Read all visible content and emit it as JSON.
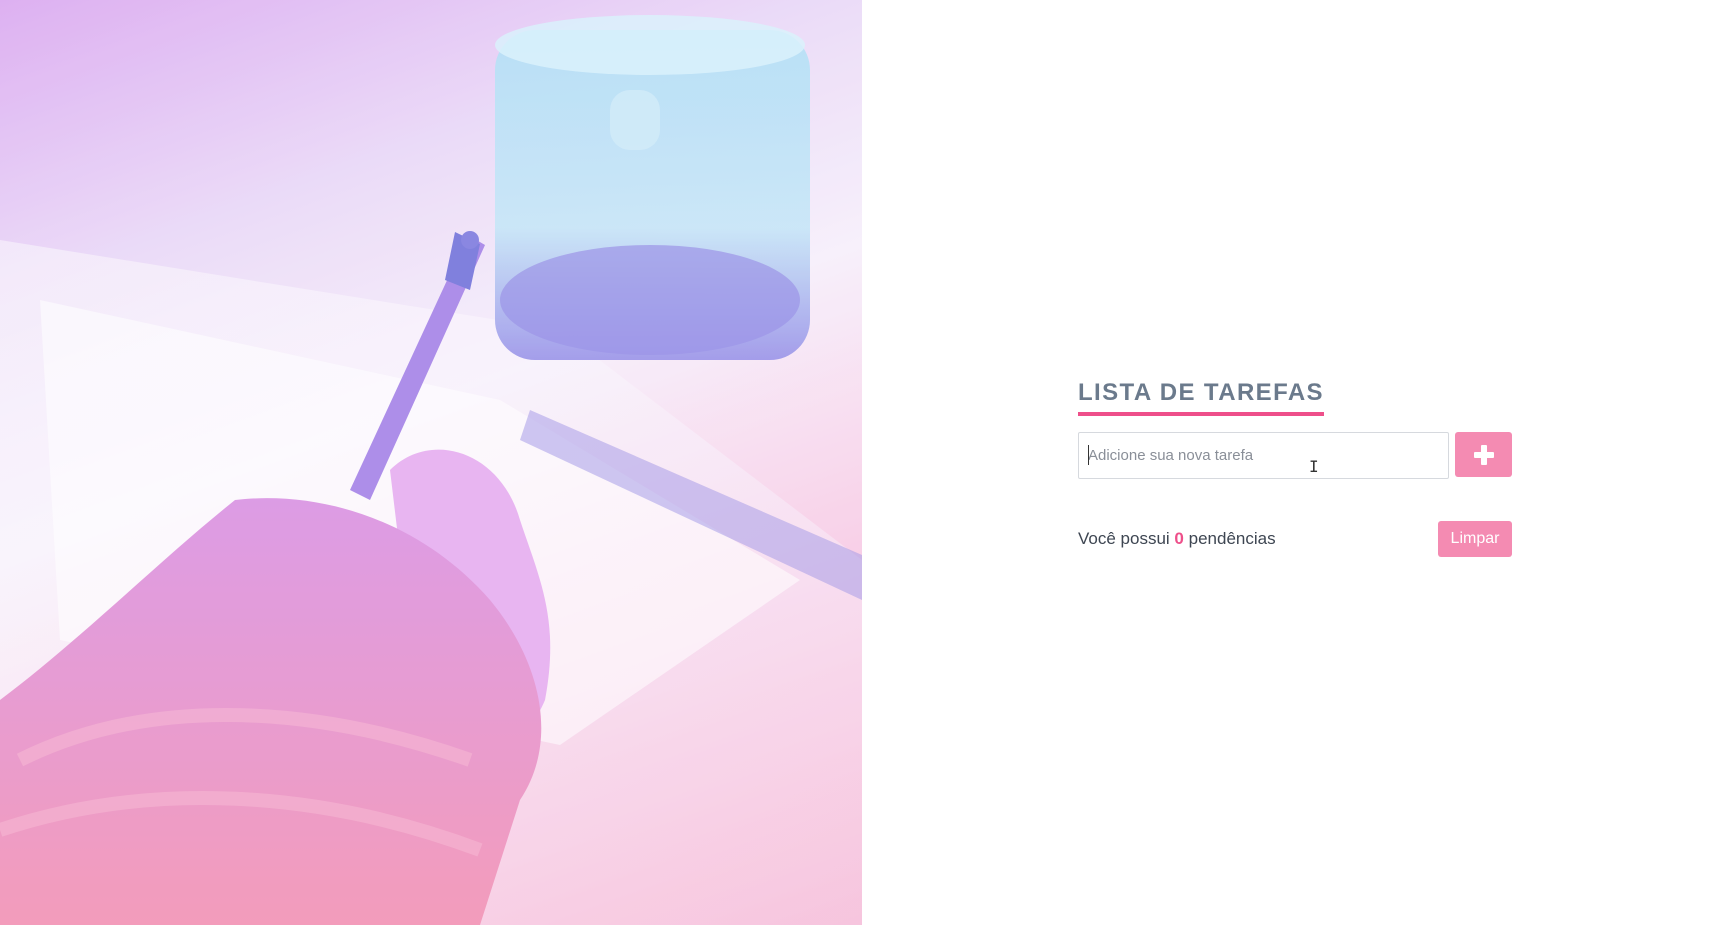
{
  "header": {
    "title": "LISTA DE TAREFAS"
  },
  "new_task": {
    "value": "",
    "placeholder": "Adicione sua nova tarefa"
  },
  "add_button": {
    "icon": "plus-icon"
  },
  "footer": {
    "pending_prefix": "Você possui",
    "pending_count": "0",
    "pending_suffix": "pendências",
    "clear_label": "Limpar"
  },
  "colors": {
    "accent": "#ee4f8a",
    "button": "#f48bb2",
    "title": "#6b7a8c"
  }
}
